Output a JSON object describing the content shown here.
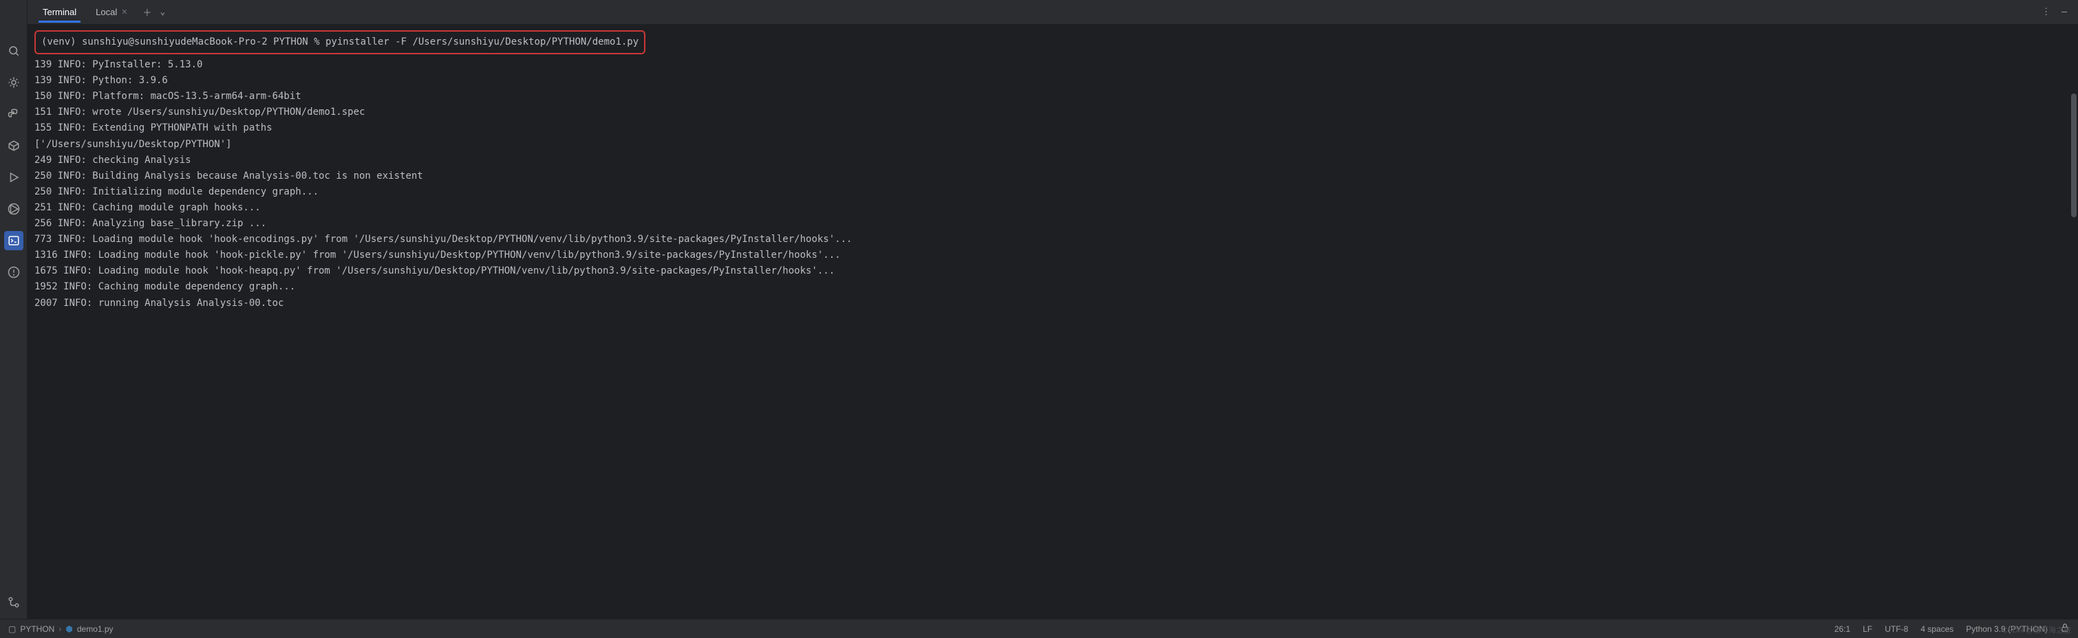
{
  "tabs": {
    "terminal": "Terminal",
    "local": "Local"
  },
  "command": "(venv) sunshiyu@sunshiyudeMacBook-Pro-2 PYTHON % pyinstaller -F /Users/sunshiyu/Desktop/PYTHON/demo1.py",
  "output": [
    "139 INFO: PyInstaller: 5.13.0",
    "139 INFO: Python: 3.9.6",
    "150 INFO: Platform: macOS-13.5-arm64-arm-64bit",
    "151 INFO: wrote /Users/sunshiyu/Desktop/PYTHON/demo1.spec",
    "155 INFO: Extending PYTHONPATH with paths",
    "['/Users/sunshiyu/Desktop/PYTHON']",
    "249 INFO: checking Analysis",
    "250 INFO: Building Analysis because Analysis-00.toc is non existent",
    "250 INFO: Initializing module dependency graph...",
    "251 INFO: Caching module graph hooks...",
    "256 INFO: Analyzing base_library.zip ...",
    "773 INFO: Loading module hook 'hook-encodings.py' from '/Users/sunshiyu/Desktop/PYTHON/venv/lib/python3.9/site-packages/PyInstaller/hooks'...",
    "1316 INFO: Loading module hook 'hook-pickle.py' from '/Users/sunshiyu/Desktop/PYTHON/venv/lib/python3.9/site-packages/PyInstaller/hooks'...",
    "1675 INFO: Loading module hook 'hook-heapq.py' from '/Users/sunshiyu/Desktop/PYTHON/venv/lib/python3.9/site-packages/PyInstaller/hooks'...",
    "1952 INFO: Caching module dependency graph...",
    "2007 INFO: running Analysis Analysis-00.toc"
  ],
  "breadcrumb": {
    "project": "PYTHON",
    "file": "demo1.py"
  },
  "status": {
    "cursor": "26:1",
    "line_ending": "LF",
    "encoding": "UTF-8",
    "indent": "4 spaces",
    "interpreter": "Python 3.9 (PYTHON)"
  },
  "watermark": "CSDN @爱琴海之旅"
}
